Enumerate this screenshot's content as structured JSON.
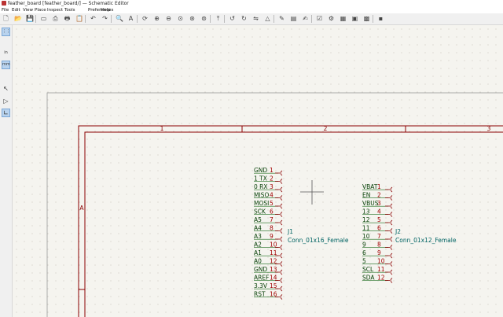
{
  "window": {
    "title": "feather_board [feather_board/] — Schematic Editor"
  },
  "menu": [
    "File",
    "Edit",
    "View",
    "Place",
    "Inspect",
    "Tools",
    "Preferences",
    "Help"
  ],
  "toolbar": [
    {
      "name": "new-icon",
      "glyph": "🗋"
    },
    {
      "name": "open-icon",
      "glyph": "📂"
    },
    {
      "name": "save-icon",
      "glyph": "💾"
    },
    {
      "name": "page-settings-icon",
      "glyph": "▭"
    },
    {
      "name": "print-icon",
      "glyph": "⎙"
    },
    {
      "name": "plot-icon",
      "glyph": "🖶"
    },
    {
      "name": "paste-icon",
      "glyph": "📋"
    },
    {
      "name": "undo-icon",
      "glyph": "↶"
    },
    {
      "name": "redo-icon",
      "glyph": "↷"
    },
    {
      "name": "find-icon",
      "glyph": "🔍"
    },
    {
      "name": "find-replace-icon",
      "glyph": "A"
    },
    {
      "name": "refresh-icon",
      "glyph": "⟳"
    },
    {
      "name": "zoom-in-icon",
      "glyph": "⊕"
    },
    {
      "name": "zoom-out-icon",
      "glyph": "⊖"
    },
    {
      "name": "zoom-fit-icon",
      "glyph": "⊙"
    },
    {
      "name": "zoom-objects-icon",
      "glyph": "⊛"
    },
    {
      "name": "zoom-selection-icon",
      "glyph": "⊚"
    },
    {
      "name": "navigate-up-icon",
      "glyph": "⤒"
    },
    {
      "name": "rotate-ccw-icon",
      "glyph": "↺"
    },
    {
      "name": "rotate-cw-icon",
      "glyph": "↻"
    },
    {
      "name": "mirror-v-icon",
      "glyph": "⇋"
    },
    {
      "name": "mirror-h-icon",
      "glyph": "△"
    },
    {
      "name": "symbol-editor-icon",
      "glyph": "✎"
    },
    {
      "name": "symbol-browser-icon",
      "glyph": "▤"
    },
    {
      "name": "annotate-icon",
      "glyph": "✍"
    },
    {
      "name": "erc-icon",
      "glyph": "☑"
    },
    {
      "name": "footprint-assign-icon",
      "glyph": "⚙"
    },
    {
      "name": "bom-icon",
      "glyph": "▦"
    },
    {
      "name": "netlist-icon",
      "glyph": "▣"
    },
    {
      "name": "pcb-editor-icon",
      "glyph": "▩"
    },
    {
      "name": "scripting-console-icon",
      "glyph": "▪"
    }
  ],
  "left_toolbar": [
    {
      "name": "grid-icon",
      "glyph": "⋮⋮"
    },
    {
      "name": "units-inch-icon",
      "glyph": "in"
    },
    {
      "name": "units-mm-icon",
      "glyph": "mm"
    },
    {
      "name": "cursor-shape-icon",
      "glyph": "↖"
    },
    {
      "name": "hidden-pins-icon",
      "glyph": "▷"
    },
    {
      "name": "wire-angle-icon",
      "glyph": "∟"
    }
  ],
  "colors": {
    "border": "#8a0000",
    "pin_name": "#084108",
    "pin_number": "#a00000",
    "reference": "#006464",
    "body": "#8a0000"
  },
  "sheet": {
    "columns": [
      "1",
      "2",
      "3"
    ],
    "rows": [
      "A"
    ]
  },
  "components": [
    {
      "ref": "J1",
      "value": "Conn_01x16_Female",
      "pins": [
        {
          "name": "GND",
          "num": "1"
        },
        {
          "name": "1 TX",
          "num": "2"
        },
        {
          "name": "0 RX",
          "num": "3"
        },
        {
          "name": "MISO",
          "num": "4"
        },
        {
          "name": "MOSI",
          "num": "5"
        },
        {
          "name": "SCK",
          "num": "6"
        },
        {
          "name": "A5",
          "num": "7"
        },
        {
          "name": "A4",
          "num": "8"
        },
        {
          "name": "A3",
          "num": "9"
        },
        {
          "name": "A2",
          "num": "10"
        },
        {
          "name": "A1",
          "num": "11"
        },
        {
          "name": "A0",
          "num": "12"
        },
        {
          "name": "GND",
          "num": "13"
        },
        {
          "name": "AREF",
          "num": "14"
        },
        {
          "name": "3.3V",
          "num": "15"
        },
        {
          "name": "RST",
          "num": "16"
        }
      ]
    },
    {
      "ref": "J2",
      "value": "Conn_01x12_Female",
      "pins": [
        {
          "name": "VBAT",
          "num": "1"
        },
        {
          "name": "EN",
          "num": "2"
        },
        {
          "name": "VBUS",
          "num": "3"
        },
        {
          "name": "13",
          "num": "4"
        },
        {
          "name": "12",
          "num": "5"
        },
        {
          "name": "11",
          "num": "6"
        },
        {
          "name": "10",
          "num": "7"
        },
        {
          "name": "9",
          "num": "8"
        },
        {
          "name": "6",
          "num": "9"
        },
        {
          "name": "5",
          "num": "10"
        },
        {
          "name": "SCL",
          "num": "11"
        },
        {
          "name": "SDA",
          "num": "12"
        }
      ]
    }
  ]
}
